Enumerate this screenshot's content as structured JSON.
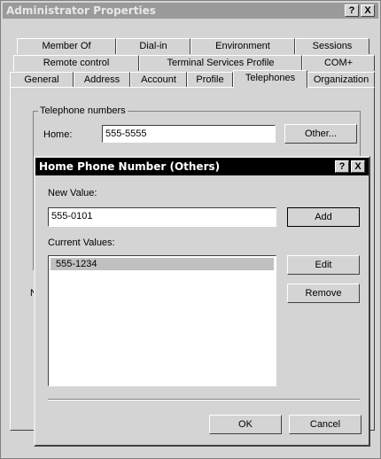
{
  "window": {
    "title": "Administrator Properties",
    "help_label": "?",
    "close_label": "X"
  },
  "tabs": {
    "row1": [
      "Member Of",
      "Dial-in",
      "Environment",
      "Sessions"
    ],
    "row2": [
      "Remote control",
      "Terminal Services Profile",
      "COM+"
    ],
    "row3": [
      "General",
      "Address",
      "Account",
      "Profile",
      "Telephones",
      "Organization"
    ],
    "selected": "Telephones"
  },
  "telephones": {
    "group_label": "Telephone numbers",
    "home_label": "Home:",
    "home_value": "555-5555",
    "other_button": "Other...",
    "notes_label_partial": "N"
  },
  "dialog": {
    "title": "Home Phone Number (Others)",
    "help_label": "?",
    "close_label": "X",
    "new_value_label": "New Value:",
    "new_value": "555-0101",
    "add_button": "Add",
    "current_values_label": "Current Values:",
    "current_values": [
      "555-1234"
    ],
    "edit_button": "Edit",
    "remove_button": "Remove",
    "ok_button": "OK",
    "cancel_button": "Cancel"
  }
}
